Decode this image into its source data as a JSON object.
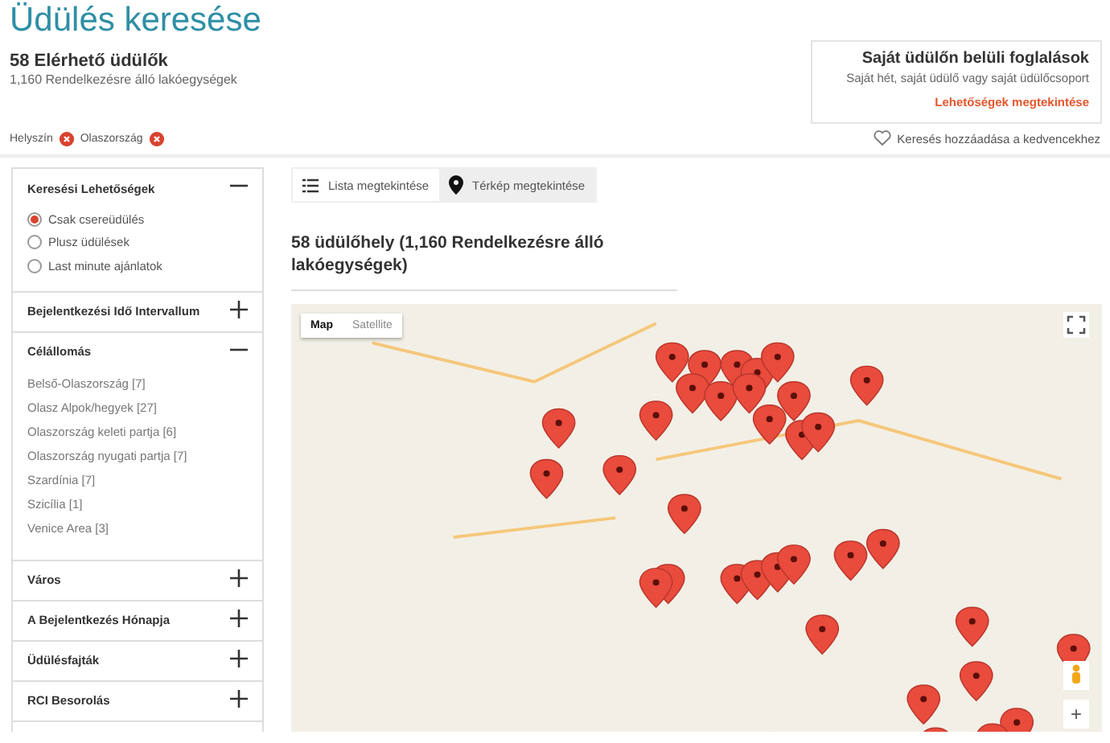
{
  "page_title": "Üdülés keresése",
  "summary": {
    "count": "58 Elérhető üdülők",
    "units": "1,160 Rendelkezésre álló lakóegységek"
  },
  "promo": {
    "title": "Saját üdülőn belüli foglalások",
    "text": "Saját hét, saját üdülő vagy saját üdülőcsoport",
    "link": "Lehetőségek megtekintése"
  },
  "filters": [
    {
      "label": "Helyszín"
    },
    {
      "label": "Olaszország"
    }
  ],
  "favorite": {
    "label": "Keresés hozzáadása a kedvencekhez"
  },
  "sidebar": [
    {
      "title": "Keresési Lehetőségek",
      "expanded": true,
      "kind": "radio",
      "options": [
        {
          "label": "Csak csereüdülés",
          "selected": true
        },
        {
          "label": "Plusz üdülések",
          "selected": false
        },
        {
          "label": "Last minute ajánlatok",
          "selected": false
        }
      ]
    },
    {
      "title": "Bejelentkezési Idő Intervallum",
      "expanded": false,
      "kind": "plain"
    },
    {
      "title": "Célállomás",
      "expanded": true,
      "kind": "links",
      "options": [
        {
          "label": "Belső-Olaszország",
          "count": "[7]"
        },
        {
          "label": "Olasz Alpok/hegyek",
          "count": "[27]"
        },
        {
          "label": "Olaszország keleti partja",
          "count": "[6]"
        },
        {
          "label": "Olaszország nyugati partja",
          "count": "[7]"
        },
        {
          "label": "Szardínia",
          "count": "[7]"
        },
        {
          "label": "Szicília",
          "count": "[1]"
        },
        {
          "label": "Venice Area",
          "count": "[3]"
        }
      ]
    },
    {
      "title": "Város",
      "expanded": false,
      "kind": "plain"
    },
    {
      "title": "A Bejelentkezés Hónapja",
      "expanded": false,
      "kind": "plain"
    },
    {
      "title": "Üdülésfajták",
      "expanded": false,
      "kind": "plain"
    },
    {
      "title": "RCI Besorolás",
      "expanded": false,
      "kind": "plain"
    }
  ],
  "view_tabs": [
    {
      "label": "Lista megtekintése",
      "kind": "list",
      "selected": false
    },
    {
      "label": "Térkép megtekintése",
      "kind": "map",
      "selected": true
    }
  ],
  "results_heading": "58 üdülőhely (1,160 Rendelkezésre álló lakóegységek)",
  "map": {
    "type_buttons": [
      {
        "label": "Map",
        "selected": true
      },
      {
        "label": "Satellite",
        "selected": false
      }
    ],
    "zoom_in": "+"
  }
}
